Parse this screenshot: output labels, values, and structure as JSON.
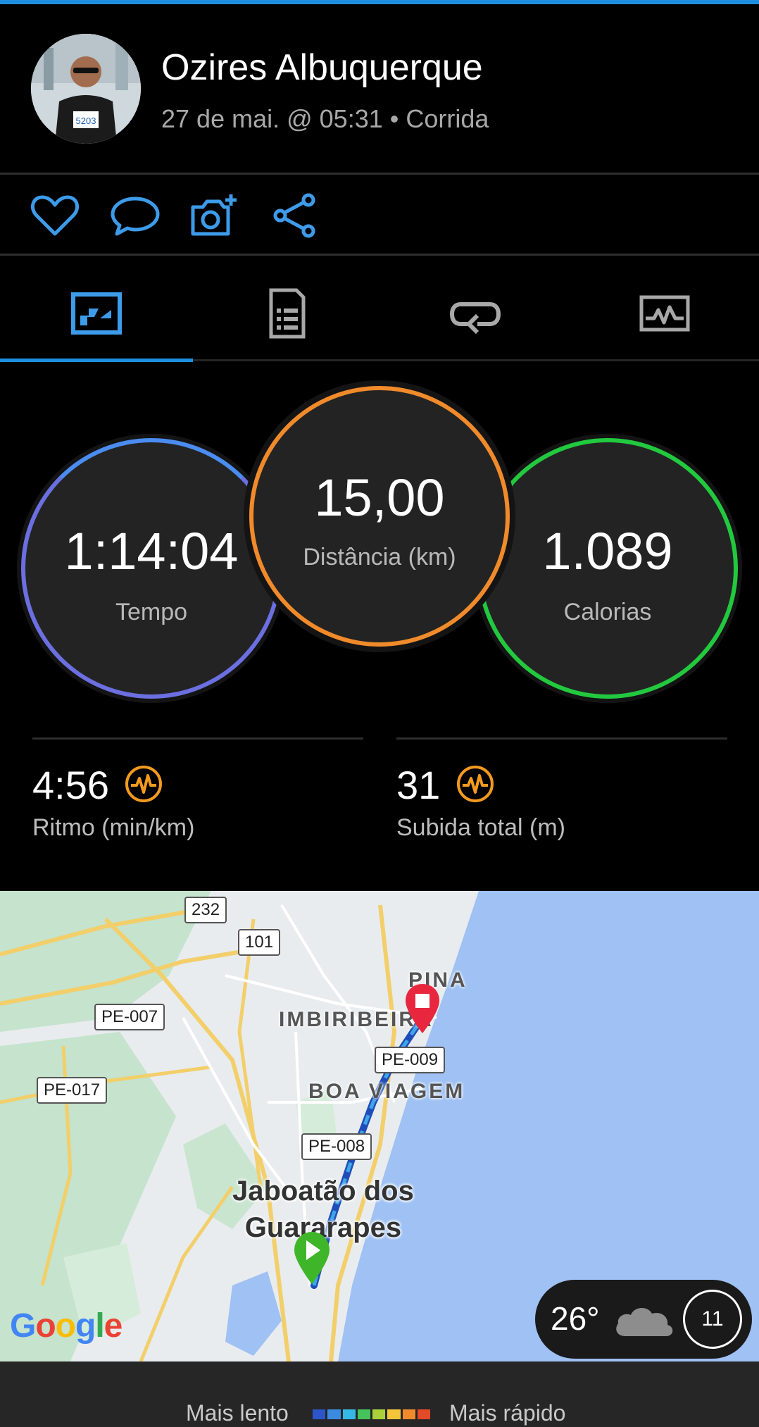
{
  "header": {
    "user_name": "Ozires Albuquerque",
    "activity_meta": "27 de mai. @ 05:31 • Corrida",
    "avatar_bib": "5203"
  },
  "actions": [
    {
      "name": "like",
      "icon": "heart-icon"
    },
    {
      "name": "comment",
      "icon": "comment-icon"
    },
    {
      "name": "add-photo",
      "icon": "camera-add-icon"
    },
    {
      "name": "share",
      "icon": "share-icon"
    }
  ],
  "tabs": [
    {
      "icon": "overview-icon",
      "active": true
    },
    {
      "icon": "details-icon",
      "active": false
    },
    {
      "icon": "laps-icon",
      "active": false
    },
    {
      "icon": "charts-icon",
      "active": false
    }
  ],
  "stats": {
    "time": {
      "value": "1:14:04",
      "label": "Tempo"
    },
    "distance": {
      "value": "15,00",
      "label": "Distância (km)"
    },
    "calories": {
      "value": "1.089",
      "label": "Calorias"
    },
    "pace": {
      "value": "4:56",
      "label": "Ritmo (min/km)"
    },
    "ascent": {
      "value": "31",
      "label": "Subida total (m)"
    }
  },
  "colors": {
    "accent": "#1e8fe0",
    "time_ring": "#6b6fe0",
    "distance_ring": "#f08a2a",
    "calories_ring": "#22c93f",
    "effort_icon": "#f39a1e"
  },
  "map": {
    "road_shields": [
      "232",
      "101",
      "PE-007",
      "PE-017",
      "PE-009",
      "PE-008"
    ],
    "areas": [
      "PINA",
      "IMBIRIBEIRA",
      "BOA VIAGEM"
    ],
    "city": [
      "Jaboatão dos",
      "Guararapes"
    ],
    "provider": "Google",
    "weather": {
      "temperature": "26°",
      "wind_speed": "11",
      "icon": "cloud-icon"
    }
  },
  "legend": {
    "slow": "Mais lento",
    "fast": "Mais rápido",
    "gradient": [
      "#2b55c9",
      "#3a8be0",
      "#35b8e6",
      "#46c25a",
      "#a9d23a",
      "#f2c53a",
      "#f08a2a",
      "#e24a2a"
    ]
  }
}
